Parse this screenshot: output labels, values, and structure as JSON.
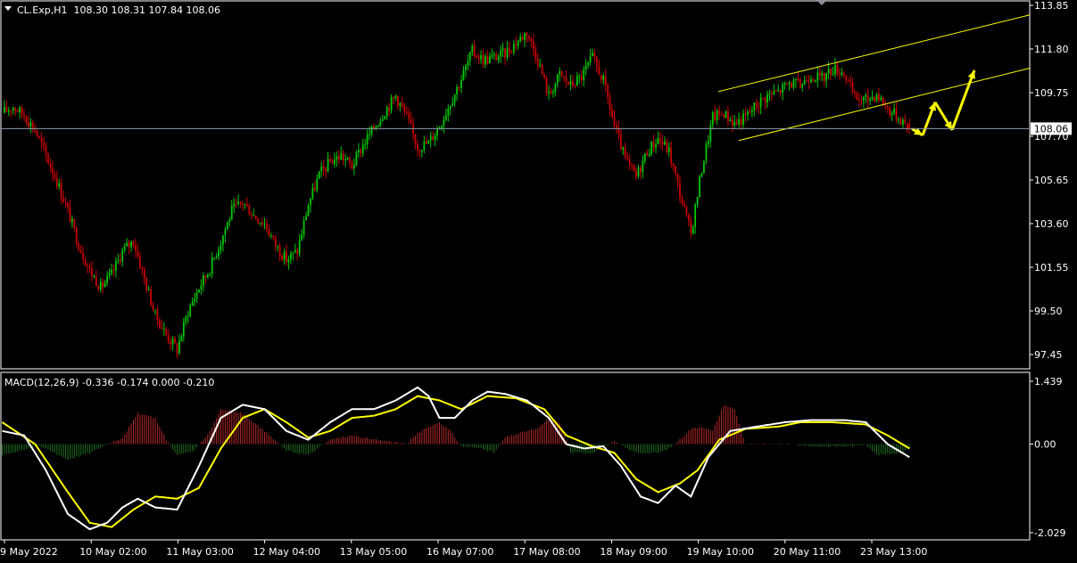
{
  "main_header": {
    "symbol_line": "CL.Exp,H1  108.30 108.31 107.84 108.06"
  },
  "macd_header": {
    "text": "MACD(12,26,9) -0.336 -0.174 0.000 -0.210"
  },
  "colors": {
    "background": "#000000",
    "frame": "#ffffff",
    "bull_candle": "#00c800",
    "bear_candle": "#c80000",
    "channel_line": "#ffff00",
    "projection_arrow": "#ffff00",
    "price_line": "#8c9cb0",
    "macd_line": "#ffffff",
    "signal_line": "#ffff00",
    "hist_positive": "#b42828",
    "hist_negative": "#1e6e1e"
  },
  "chart_data": [
    {
      "type": "candlestick",
      "title": "CL.Exp,H1",
      "timeframe": "H1",
      "ylim": [
        96.9,
        114.1
      ],
      "y_ticks": [
        "113.85",
        "111.80",
        "109.75",
        "107.70",
        "105.65",
        "103.60",
        "101.55",
        "99.50",
        "97.45"
      ],
      "x_tick_labels": [
        "9 May 2022",
        "10 May 02:00",
        "11 May 03:00",
        "12 May 04:00",
        "13 May 05:00",
        "16 May 07:00",
        "17 May 08:00",
        "18 May 09:00",
        "19 May 10:00",
        "20 May 11:00",
        "23 May 13:00"
      ],
      "current_price": "108.06",
      "last_bar": {
        "open": 108.3,
        "high": 108.31,
        "low": 107.84,
        "close": 108.06
      },
      "close_path": [
        [
          0,
          108.8
        ],
        [
          5,
          109.1
        ],
        [
          10,
          108.7
        ],
        [
          15,
          108.0
        ],
        [
          20,
          106.8
        ],
        [
          25,
          105.6
        ],
        [
          30,
          104.2
        ],
        [
          35,
          102.6
        ],
        [
          40,
          101.4
        ],
        [
          45,
          100.6
        ],
        [
          50,
          101.2
        ],
        [
          55,
          102.3
        ],
        [
          60,
          102.8
        ],
        [
          65,
          101.0
        ],
        [
          70,
          99.3
        ],
        [
          75,
          98.4
        ],
        [
          80,
          97.7
        ],
        [
          85,
          99.5
        ],
        [
          90,
          100.6
        ],
        [
          95,
          101.5
        ],
        [
          100,
          102.8
        ],
        [
          105,
          104.2
        ],
        [
          110,
          104.6
        ],
        [
          115,
          104.0
        ],
        [
          120,
          103.6
        ],
        [
          125,
          102.6
        ],
        [
          130,
          101.9
        ],
        [
          135,
          102.3
        ],
        [
          140,
          104.5
        ],
        [
          145,
          105.9
        ],
        [
          150,
          106.5
        ],
        [
          155,
          106.8
        ],
        [
          160,
          106.3
        ],
        [
          165,
          107.3
        ],
        [
          170,
          108.1
        ],
        [
          175,
          108.9
        ],
        [
          180,
          109.6
        ],
        [
          185,
          108.6
        ],
        [
          190,
          107.2
        ],
        [
          195,
          107.4
        ],
        [
          200,
          108.2
        ],
        [
          205,
          109.3
        ],
        [
          210,
          110.4
        ],
        [
          215,
          111.7
        ],
        [
          220,
          111.3
        ],
        [
          225,
          111.4
        ],
        [
          230,
          111.6
        ],
        [
          235,
          112.1
        ],
        [
          240,
          112.6
        ],
        [
          245,
          111.3
        ],
        [
          250,
          109.6
        ],
        [
          255,
          110.6
        ],
        [
          260,
          110.1
        ],
        [
          265,
          110.5
        ],
        [
          270,
          111.4
        ],
        [
          275,
          110.3
        ],
        [
          280,
          108.2
        ],
        [
          285,
          106.6
        ],
        [
          290,
          105.8
        ],
        [
          295,
          107.0
        ],
        [
          300,
          107.6
        ],
        [
          305,
          107.0
        ],
        [
          310,
          105.0
        ],
        [
          315,
          103.1
        ],
        [
          320,
          106.2
        ],
        [
          325,
          108.6
        ],
        [
          330,
          108.8
        ],
        [
          335,
          108.3
        ],
        [
          340,
          108.6
        ],
        [
          345,
          109.2
        ],
        [
          350,
          109.6
        ],
        [
          355,
          109.8
        ],
        [
          360,
          110.2
        ],
        [
          365,
          110.1
        ],
        [
          370,
          110.6
        ],
        [
          375,
          110.4
        ],
        [
          380,
          110.9
        ],
        [
          385,
          110.7
        ],
        [
          390,
          109.5
        ],
        [
          395,
          109.4
        ],
        [
          400,
          109.7
        ],
        [
          405,
          109.0
        ],
        [
          410,
          108.6
        ],
        [
          415,
          108.1
        ]
      ]
    },
    {
      "type": "macd",
      "title": "MACD(12,26,9)",
      "parameters": [
        12,
        26,
        9
      ],
      "header_values": [
        -0.336,
        -0.174,
        0.0,
        -0.21
      ],
      "ylim": [
        -2.1,
        1.55
      ],
      "y_ticks": [
        "1.439",
        "0.00",
        "-2.029"
      ],
      "macd": [
        [
          0,
          0.3
        ],
        [
          10,
          0.2
        ],
        [
          20,
          -0.6
        ],
        [
          30,
          -1.6
        ],
        [
          40,
          -1.95
        ],
        [
          48,
          -1.8
        ],
        [
          55,
          -1.45
        ],
        [
          62,
          -1.25
        ],
        [
          70,
          -1.45
        ],
        [
          80,
          -1.5
        ],
        [
          90,
          -0.5
        ],
        [
          100,
          0.6
        ],
        [
          110,
          0.9
        ],
        [
          120,
          0.8
        ],
        [
          130,
          0.3
        ],
        [
          140,
          0.1
        ],
        [
          150,
          0.5
        ],
        [
          160,
          0.8
        ],
        [
          170,
          0.8
        ],
        [
          180,
          1.0
        ],
        [
          190,
          1.3
        ],
        [
          195,
          1.1
        ],
        [
          200,
          0.6
        ],
        [
          207,
          0.6
        ],
        [
          215,
          1.0
        ],
        [
          222,
          1.2
        ],
        [
          230,
          1.15
        ],
        [
          240,
          1.0
        ],
        [
          250,
          0.6
        ],
        [
          258,
          0.0
        ],
        [
          266,
          -0.1
        ],
        [
          275,
          -0.05
        ],
        [
          283,
          -0.5
        ],
        [
          292,
          -1.2
        ],
        [
          300,
          -1.35
        ],
        [
          308,
          -0.95
        ],
        [
          315,
          -1.2
        ],
        [
          323,
          -0.3
        ],
        [
          333,
          0.3
        ],
        [
          345,
          0.4
        ],
        [
          358,
          0.5
        ],
        [
          370,
          0.55
        ],
        [
          385,
          0.55
        ],
        [
          395,
          0.5
        ],
        [
          405,
          0.0
        ],
        [
          415,
          -0.3
        ]
      ],
      "signal": [
        [
          0,
          0.5
        ],
        [
          15,
          0.0
        ],
        [
          30,
          -1.1
        ],
        [
          40,
          -1.8
        ],
        [
          50,
          -1.9
        ],
        [
          60,
          -1.5
        ],
        [
          70,
          -1.2
        ],
        [
          80,
          -1.25
        ],
        [
          90,
          -1.0
        ],
        [
          100,
          -0.1
        ],
        [
          110,
          0.6
        ],
        [
          120,
          0.8
        ],
        [
          130,
          0.5
        ],
        [
          140,
          0.15
        ],
        [
          150,
          0.3
        ],
        [
          160,
          0.6
        ],
        [
          170,
          0.65
        ],
        [
          180,
          0.8
        ],
        [
          190,
          1.1
        ],
        [
          200,
          1.0
        ],
        [
          210,
          0.8
        ],
        [
          222,
          1.1
        ],
        [
          235,
          1.05
        ],
        [
          248,
          0.8
        ],
        [
          258,
          0.2
        ],
        [
          270,
          -0.05
        ],
        [
          280,
          -0.2
        ],
        [
          290,
          -0.8
        ],
        [
          300,
          -1.1
        ],
        [
          310,
          -0.9
        ],
        [
          318,
          -0.6
        ],
        [
          328,
          0.1
        ],
        [
          340,
          0.35
        ],
        [
          355,
          0.4
        ],
        [
          365,
          0.5
        ],
        [
          380,
          0.5
        ],
        [
          395,
          0.45
        ],
        [
          405,
          0.2
        ],
        [
          415,
          -0.1
        ]
      ],
      "histogram_envelope": [
        [
          0,
          -0.25
        ],
        [
          8,
          -0.15
        ],
        [
          15,
          -0.05
        ],
        [
          20,
          -0.1
        ],
        [
          30,
          -0.35
        ],
        [
          40,
          -0.2
        ],
        [
          48,
          0.0
        ],
        [
          55,
          0.15
        ],
        [
          62,
          0.7
        ],
        [
          70,
          0.6
        ],
        [
          75,
          0.1
        ],
        [
          80,
          -0.25
        ],
        [
          88,
          -0.15
        ],
        [
          95,
          0.3
        ],
        [
          100,
          0.8
        ],
        [
          110,
          0.7
        ],
        [
          120,
          0.3
        ],
        [
          130,
          -0.15
        ],
        [
          140,
          -0.25
        ],
        [
          150,
          0.1
        ],
        [
          160,
          0.2
        ],
        [
          170,
          0.1
        ],
        [
          180,
          0.05
        ],
        [
          185,
          0.0
        ],
        [
          190,
          0.25
        ],
        [
          195,
          0.4
        ],
        [
          200,
          0.5
        ],
        [
          205,
          0.3
        ],
        [
          210,
          -0.05
        ],
        [
          220,
          -0.1
        ],
        [
          225,
          -0.2
        ],
        [
          230,
          0.15
        ],
        [
          240,
          0.3
        ],
        [
          245,
          0.35
        ],
        [
          250,
          0.6
        ],
        [
          255,
          0.5
        ],
        [
          260,
          -0.2
        ],
        [
          270,
          -0.2
        ],
        [
          275,
          -0.05
        ],
        [
          280,
          0.05
        ],
        [
          290,
          -0.2
        ],
        [
          300,
          -0.2
        ],
        [
          305,
          -0.1
        ],
        [
          310,
          0.1
        ],
        [
          315,
          0.35
        ],
        [
          320,
          0.4
        ],
        [
          325,
          0.3
        ],
        [
          330,
          0.9
        ],
        [
          335,
          0.8
        ],
        [
          340,
          0.0
        ],
        [
          350,
          0.0
        ],
        [
          360,
          0.0
        ],
        [
          370,
          -0.05
        ],
        [
          380,
          -0.05
        ],
        [
          390,
          -0.05
        ],
        [
          395,
          0.0
        ],
        [
          400,
          -0.25
        ],
        [
          410,
          -0.2
        ],
        [
          415,
          -0.1
        ]
      ]
    }
  ]
}
